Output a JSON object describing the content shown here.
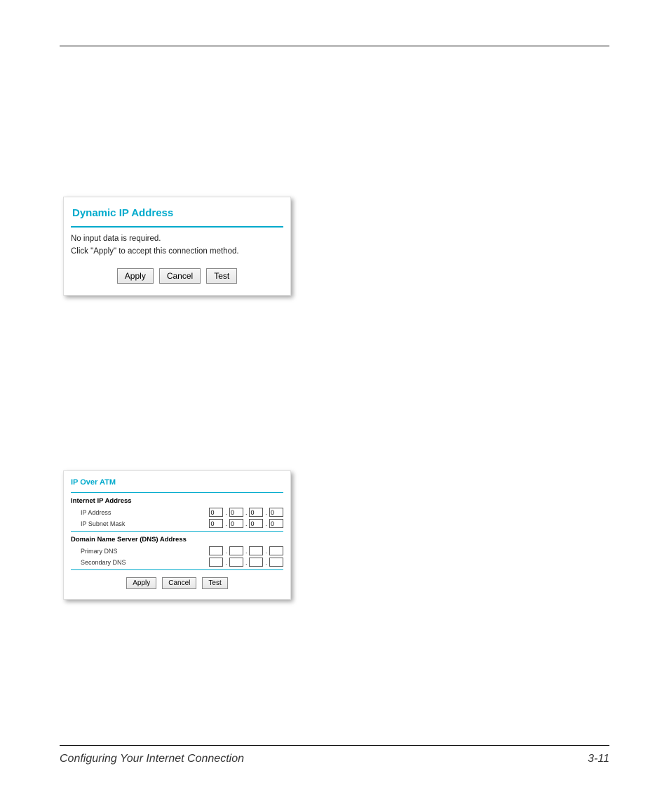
{
  "card1": {
    "title": "Dynamic IP Address",
    "line1": "No input data is required.",
    "line2": "Click \"Apply\" to accept this connection method.",
    "buttons": {
      "apply": "Apply",
      "cancel": "Cancel",
      "test": "Test"
    }
  },
  "card2": {
    "title": "IP Over ATM",
    "section1": {
      "heading": "Internet IP Address",
      "ip_label": "IP Address",
      "subnet_label": "IP Subnet Mask",
      "ip_octets": [
        "0",
        "0",
        "0",
        "0"
      ],
      "subnet_octets": [
        "0",
        "0",
        "0",
        "0"
      ]
    },
    "section2": {
      "heading": "Domain Name Server (DNS) Address",
      "primary_label": "Primary DNS",
      "secondary_label": "Secondary DNS",
      "primary_octets": [
        "",
        "",
        "",
        ""
      ],
      "secondary_octets": [
        "",
        "",
        "",
        ""
      ]
    },
    "buttons": {
      "apply": "Apply",
      "cancel": "Cancel",
      "test": "Test"
    }
  },
  "footer": {
    "left": "Configuring Your Internet Connection",
    "right": "3-11"
  }
}
